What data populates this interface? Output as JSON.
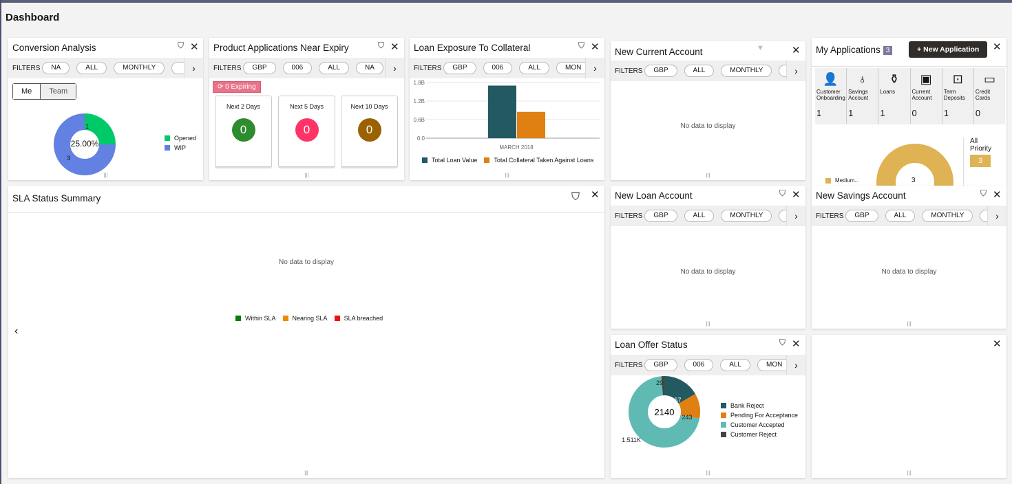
{
  "title": "Dashboard",
  "filters_label": "FILTERS",
  "no_data": "No data to display",
  "conversion": {
    "title": "Conversion Analysis",
    "filters": [
      "NA",
      "ALL",
      "MONTHLY",
      ""
    ],
    "seg": [
      "Me",
      "Team"
    ],
    "center": "25.00%",
    "slices": [
      {
        "name": "Opened",
        "value": 1,
        "color": "#00c96a"
      },
      {
        "name": "WIP",
        "value": 3,
        "color": "#6380e3"
      }
    ]
  },
  "expiry": {
    "title": "Product Applications Near Expiry",
    "filters": [
      "GBP",
      "006",
      "ALL",
      "NA"
    ],
    "badge": "0 Expiring",
    "tiles": [
      {
        "label": "Next 2 Days",
        "value": "0",
        "color": "#2e8b2e"
      },
      {
        "label": "Next 5 Days",
        "value": "0",
        "color": "#ff3366"
      },
      {
        "label": "Next 10 Days",
        "value": "0",
        "color": "#9a6200"
      }
    ]
  },
  "exposure": {
    "title": "Loan Exposure To Collateral",
    "filters": [
      "GBP",
      "006",
      "ALL",
      "MON"
    ]
  },
  "chart_data": [
    {
      "type": "bar",
      "categories": [
        "MARCH 2018"
      ],
      "yticks": [
        "0.0",
        "0.6B",
        "1.2B",
        "1.8B"
      ],
      "ylim": [
        0,
        1.8
      ],
      "series": [
        {
          "name": "Total Loan Value",
          "values": [
            1.7
          ],
          "color": "#235a61"
        },
        {
          "name": "Total Collateral Taken Against Loans",
          "values": [
            0.85
          ],
          "color": "#e07f12"
        }
      ]
    },
    {
      "type": "pie",
      "center": "2140",
      "slices": [
        {
          "name": "Bank Reject",
          "value": 357,
          "label": "357",
          "color": "#235a61"
        },
        {
          "name": "Pending For Acceptance",
          "value": 243,
          "label": "243",
          "color": "#e07f12"
        },
        {
          "name": "Customer Accepted",
          "value": 1511,
          "label": "1.511K",
          "color": "#5fbab4"
        },
        {
          "name": "Customer Reject",
          "value": 29,
          "label": "29",
          "color": "#444"
        }
      ]
    }
  ],
  "current": {
    "title": "New Current Account",
    "filters": [
      "GBP",
      "ALL",
      "MONTHLY",
      ""
    ]
  },
  "myapps": {
    "title": "My Applications",
    "count": "3",
    "new_label": "New Application",
    "items": [
      {
        "label": "Customer Onboarding",
        "value": "1",
        "icon": "person-icon",
        "g": "👤"
      },
      {
        "label": "Savings Account",
        "value": "1",
        "icon": "money-bag-icon",
        "g": "♁"
      },
      {
        "label": "Loans",
        "value": "1",
        "icon": "loan-icon",
        "g": "⚱"
      },
      {
        "label": "Current Account",
        "value": "0",
        "icon": "wallet-icon",
        "g": "▣"
      },
      {
        "label": "Term Deposits",
        "value": "1",
        "icon": "safe-icon",
        "g": "⊡"
      },
      {
        "label": "Credit Cards",
        "value": "0",
        "icon": "credit-card-icon",
        "g": "▭"
      }
    ],
    "priority_label": "All Priority",
    "priority_count": "3",
    "legend": "Medium...",
    "donut_value": "3",
    "donut_color": "#dfb354"
  },
  "sla": {
    "title": "SLA Status Summary",
    "legend": [
      {
        "name": "Within SLA",
        "color": "#0a7a0a"
      },
      {
        "name": "Nearing SLA",
        "color": "#f08a00"
      },
      {
        "name": "SLA breached",
        "color": "#ee1111"
      }
    ]
  },
  "loan": {
    "title": "New Loan Account",
    "filters": [
      "GBP",
      "ALL",
      "MONTHLY",
      ""
    ]
  },
  "savings": {
    "title": "New Savings Account",
    "filters": [
      "GBP",
      "ALL",
      "MONTHLY",
      ""
    ]
  },
  "offer": {
    "title": "Loan Offer Status",
    "filters": [
      "GBP",
      "006",
      "ALL",
      "MON"
    ]
  }
}
